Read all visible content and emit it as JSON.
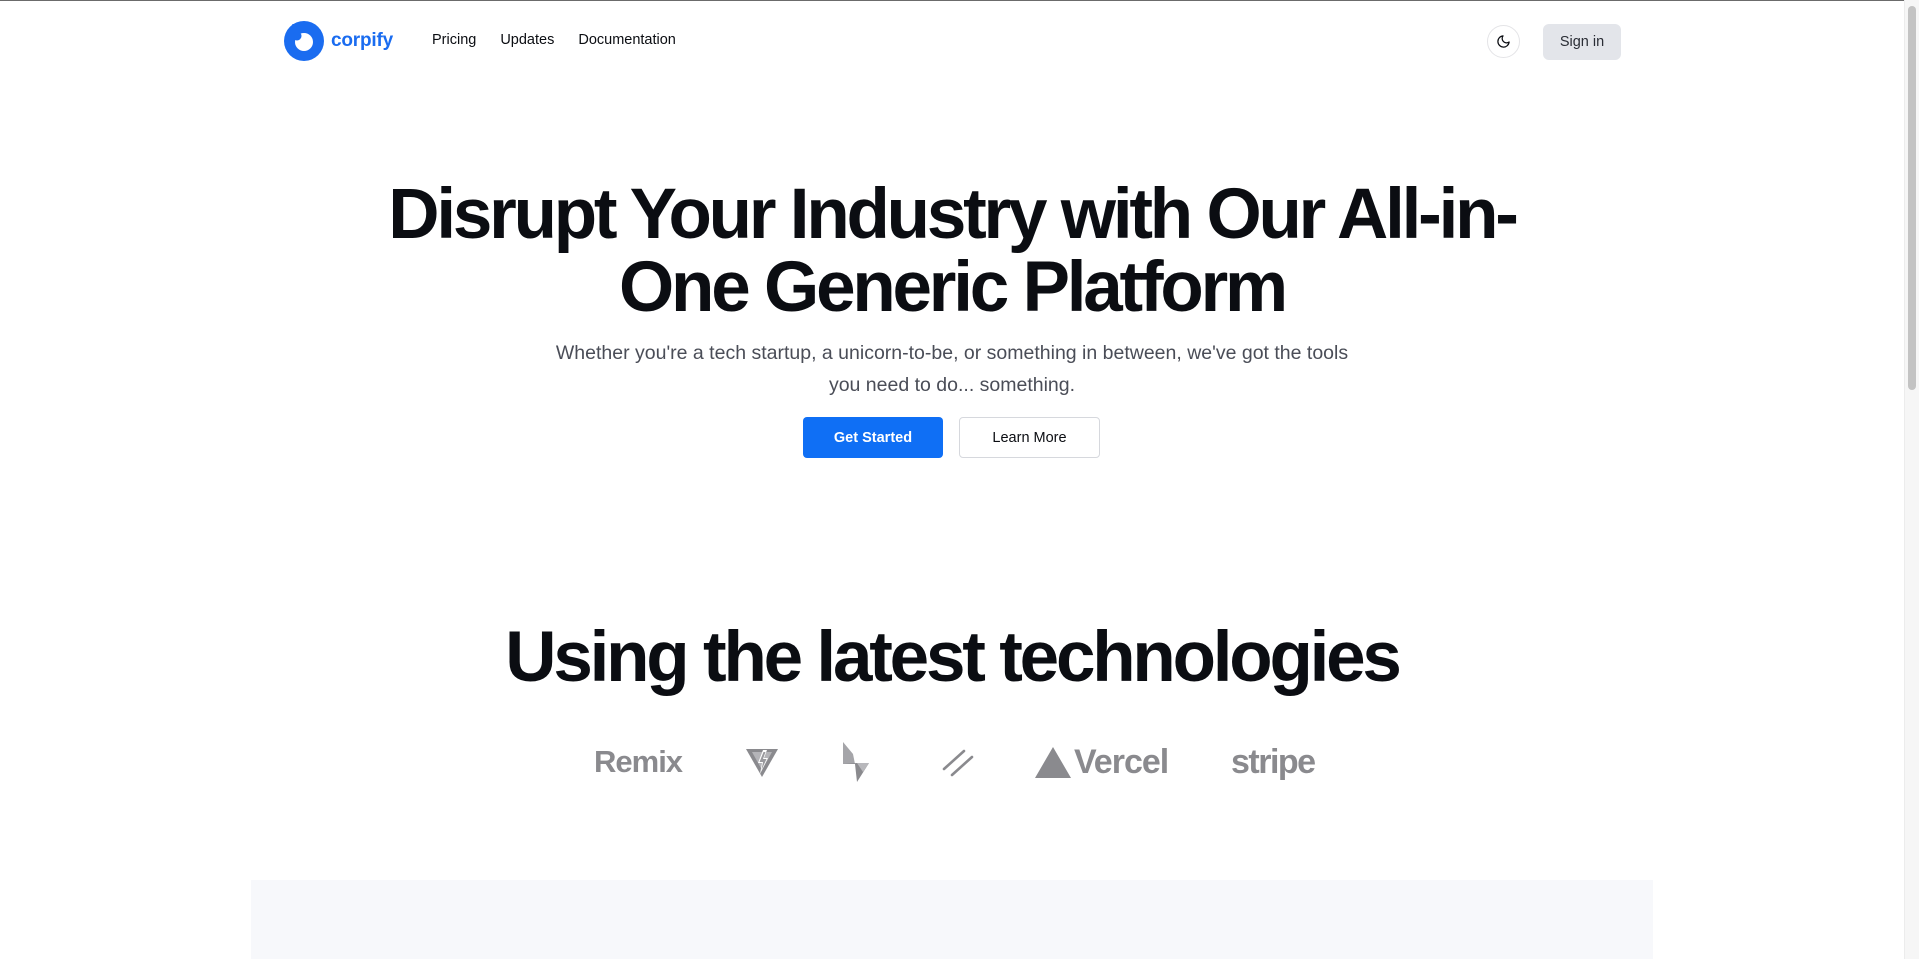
{
  "brand": {
    "name": "corpify",
    "color": "#1a6cf0"
  },
  "nav": {
    "items": [
      {
        "label": "Pricing"
      },
      {
        "label": "Updates"
      },
      {
        "label": "Documentation"
      }
    ]
  },
  "header": {
    "theme_toggle_icon": "moon-icon",
    "signin_label": "Sign in"
  },
  "hero": {
    "title": "Disrupt Your Industry with Our All-in-One Generic Platform",
    "subtitle": "Whether you're a tech startup, a unicorn-to-be, or something in between, we've got the tools you need to do... something.",
    "primary_button": "Get Started",
    "secondary_button": "Learn More",
    "primary_color": "#0f6ff5"
  },
  "technologies": {
    "title": "Using the latest technologies",
    "logos": [
      {
        "name": "remix",
        "text": "Remix"
      },
      {
        "name": "vite",
        "icon": "vite-icon"
      },
      {
        "name": "lightning",
        "icon": "lightning-icon"
      },
      {
        "name": "slashes",
        "icon": "double-slash-icon"
      },
      {
        "name": "vercel",
        "text": "Vercel"
      },
      {
        "name": "stripe",
        "text": "stripe"
      }
    ],
    "logo_color": "#8a8a8e"
  }
}
